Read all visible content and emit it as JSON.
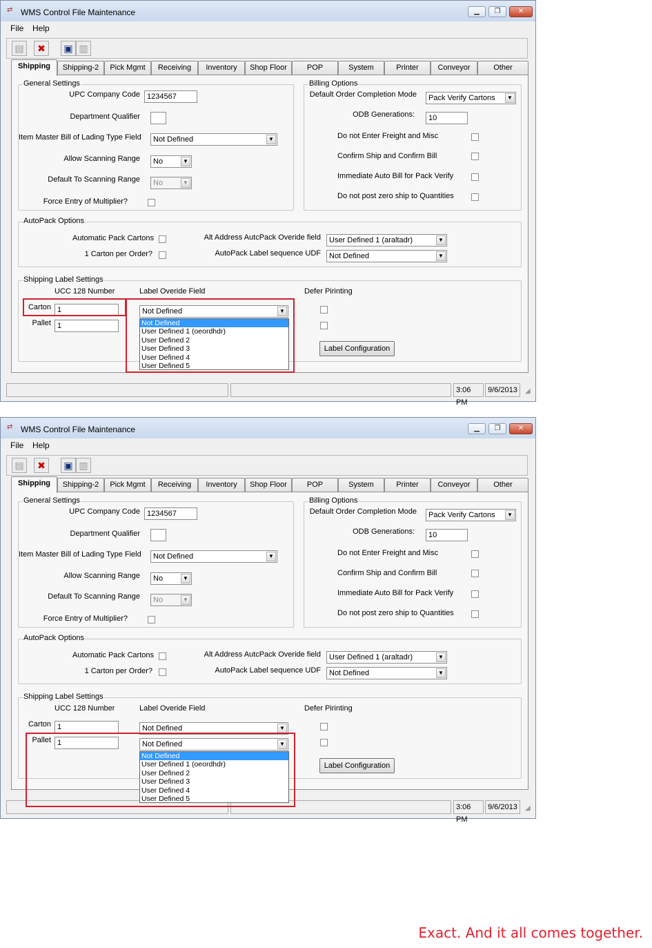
{
  "window": {
    "title": "WMS Control File Maintenance",
    "app_icon": "wms-app-icon",
    "minimize_icon": "minimize-icon",
    "maximize_icon": "restore-icon",
    "close_icon": "close-icon"
  },
  "menu": {
    "file": "File",
    "help": "Help"
  },
  "toolbar": {
    "icons": [
      "new-record-icon",
      "cancel-x-icon",
      "save-disk-icon",
      "delete-trash-icon"
    ]
  },
  "tabs": [
    "Shipping",
    "Shipping-2",
    "Pick Mgmt",
    "Receiving",
    "Inventory",
    "Shop Floor",
    "POP",
    "System",
    "Printer",
    "Conveyor",
    "Other"
  ],
  "general": {
    "title": "General Settings",
    "upc_label": "UPC Company Code",
    "upc_value": "1234567",
    "dept_label": "Department Qualifier",
    "dept_value": "",
    "bol_label": "Item Master Bill of Lading Type Field",
    "bol_value": "Not Defined",
    "allow_scan_label": "Allow Scanning Range",
    "allow_scan_value": "No",
    "default_scan_label": "Default To Scanning Range",
    "default_scan_value": "No",
    "force_label": "Force Entry of Multiplier?"
  },
  "billing": {
    "title": "Billing Options",
    "completion_label": "Default Order Completion Mode",
    "completion_value": "Pack Verify Cartons",
    "odb_label": "ODB Generations:",
    "odb_value": "10",
    "freight_label": "Do not Enter Freight and Misc",
    "confirm_label": "Confirm Ship and Confirm Bill",
    "autobill_label": "Immediate Auto Bill for Pack Verify",
    "zero_label": "Do not post zero ship to Quantities"
  },
  "autopack": {
    "title": "AutoPack Options",
    "auto_label": "Automatic Pack Cartons",
    "one_label": "1  Carton per Order?",
    "alt_label": "Alt Address AutcPack Overide field",
    "alt_value": "User Defined 1 (araltadr)",
    "seq_label": "AutoPack Label sequence UDF",
    "seq_value": "Not Defined"
  },
  "shipping_label": {
    "title": "Shipping Label Settings",
    "ucc_header": "UCC 128 Number",
    "override_header": "Label Overide Field",
    "defer_header": "Defer Pirinting",
    "carton_label": "Carton",
    "carton_value": "1",
    "carton_override": "Not Defined",
    "pallet_label": "Pallet",
    "pallet_value": "1",
    "pallet_override": "Not Defined",
    "config_button": "Label Configuration"
  },
  "dropdown_options": [
    "Not Defined",
    "User Defined 1 (oeordhdr)",
    "User Defined 2",
    "User Defined 3",
    "User Defined 4",
    "User Defined 5"
  ],
  "status": {
    "time": "3:06 PM",
    "date": "9/6/2013"
  },
  "footer": "Exact. And it all comes together.",
  "colors": {
    "highlight": "#d2202e",
    "selection": "#3399ff",
    "brand": "#e4202e"
  }
}
